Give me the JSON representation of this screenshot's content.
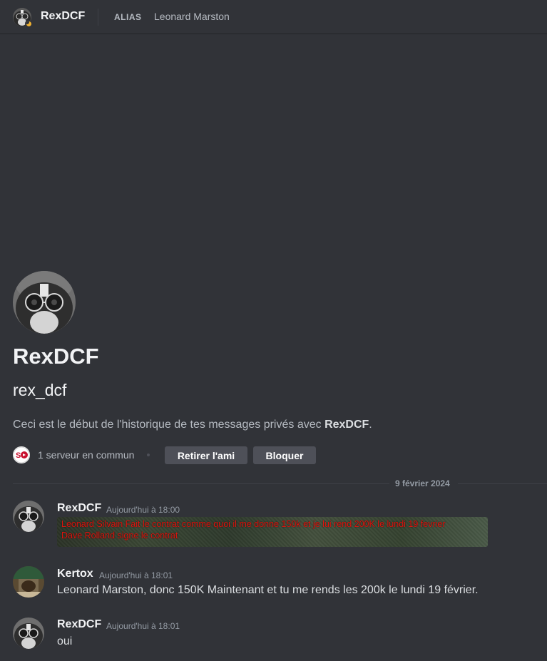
{
  "header": {
    "username": "RexDCF",
    "alias_label": "ALIAS",
    "alias_value": "Leonard Marston",
    "status": "idle"
  },
  "intro": {
    "display_name": "RexDCF",
    "username": "rex_dcf",
    "description_prefix": "Ceci est le début de l'historique de tes messages privés avec ",
    "description_name": "RexDCF",
    "description_suffix": ".",
    "mutual_servers": "1 serveur en commun",
    "remove_friend_label": "Retirer l'ami",
    "block_label": "Bloquer"
  },
  "date_divider": "9 février 2024",
  "messages": [
    {
      "author": "RexDCF",
      "timestamp": "Aujourd'hui à 18:00",
      "image_text": [
        "Leonard Silvain Fait le contrat comme quoi il me donne 150k et je lui rend 200K le lundi 19 fevrier",
        "Dave Rolland signe le contrat"
      ]
    },
    {
      "author": "Kertox",
      "timestamp": "Aujourd'hui à 18:01",
      "text": "Leonard Marston, donc 150K Maintenant et tu me rends les 200k le lundi 19 février."
    },
    {
      "author": "RexDCF",
      "timestamp": "Aujourd'hui à 18:01",
      "text": "oui"
    }
  ],
  "colors": {
    "background": "#313338",
    "button": "#4e5058",
    "idle_status": "#f0b232",
    "image_text": "#e0150f"
  }
}
